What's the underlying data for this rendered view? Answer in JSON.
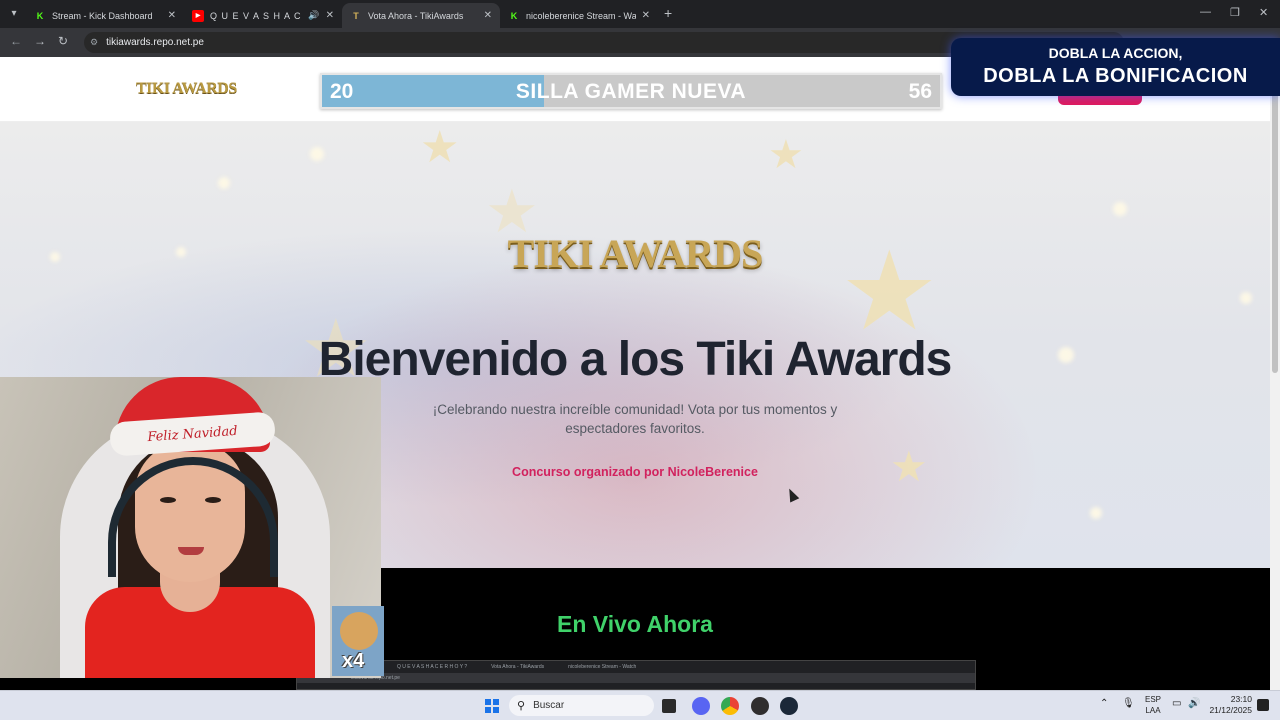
{
  "browser": {
    "tabs": [
      {
        "title": "Stream - Kick Dashboard",
        "favicon": "kick-icon",
        "active": false
      },
      {
        "title": "Q U E V A S H A C E R H O Y ?",
        "favicon": "youtube-icon",
        "active": false,
        "audio": true
      },
      {
        "title": "Vota Ahora - TikiAwards",
        "favicon": "tikiawards-icon",
        "active": true
      },
      {
        "title": "nicoleberenice Stream - Watch",
        "favicon": "kick-icon",
        "active": false
      }
    ],
    "url": "tikiawards.repo.net.pe"
  },
  "site": {
    "header": {
      "logo": "TIKI AWARDS",
      "goal": {
        "current": "20",
        "name": "SILLA GAMER NUEVA",
        "target": "56",
        "progress_fraction": 0.36
      }
    },
    "hero": {
      "logo": "TIKI AWARDS",
      "title": "Bienvenido a los Tiki Awards",
      "subtitle": "¡Celebrando nuestra increíble comunidad! Vota por tus momentos y espectadores favoritos.",
      "organizer": "Concurso organizado por NicoleBerenice"
    },
    "live": {
      "title": "En Vivo Ahora"
    }
  },
  "overlay": {
    "promo": {
      "line1": "DOBLA LA ACCION,",
      "line2": "DOBLA LA BONIFICACION"
    },
    "dog_multiplier": "x4",
    "hat_text": "Feliz Navidad"
  },
  "taskbar": {
    "search_placeholder": "Buscar",
    "language": "ESP",
    "layout": "LAA",
    "time": "23:10",
    "date": "21/12/2025"
  },
  "colors": {
    "accent_pink": "#d1225e",
    "live_green": "#40d26a",
    "gold": "#c8a657"
  }
}
